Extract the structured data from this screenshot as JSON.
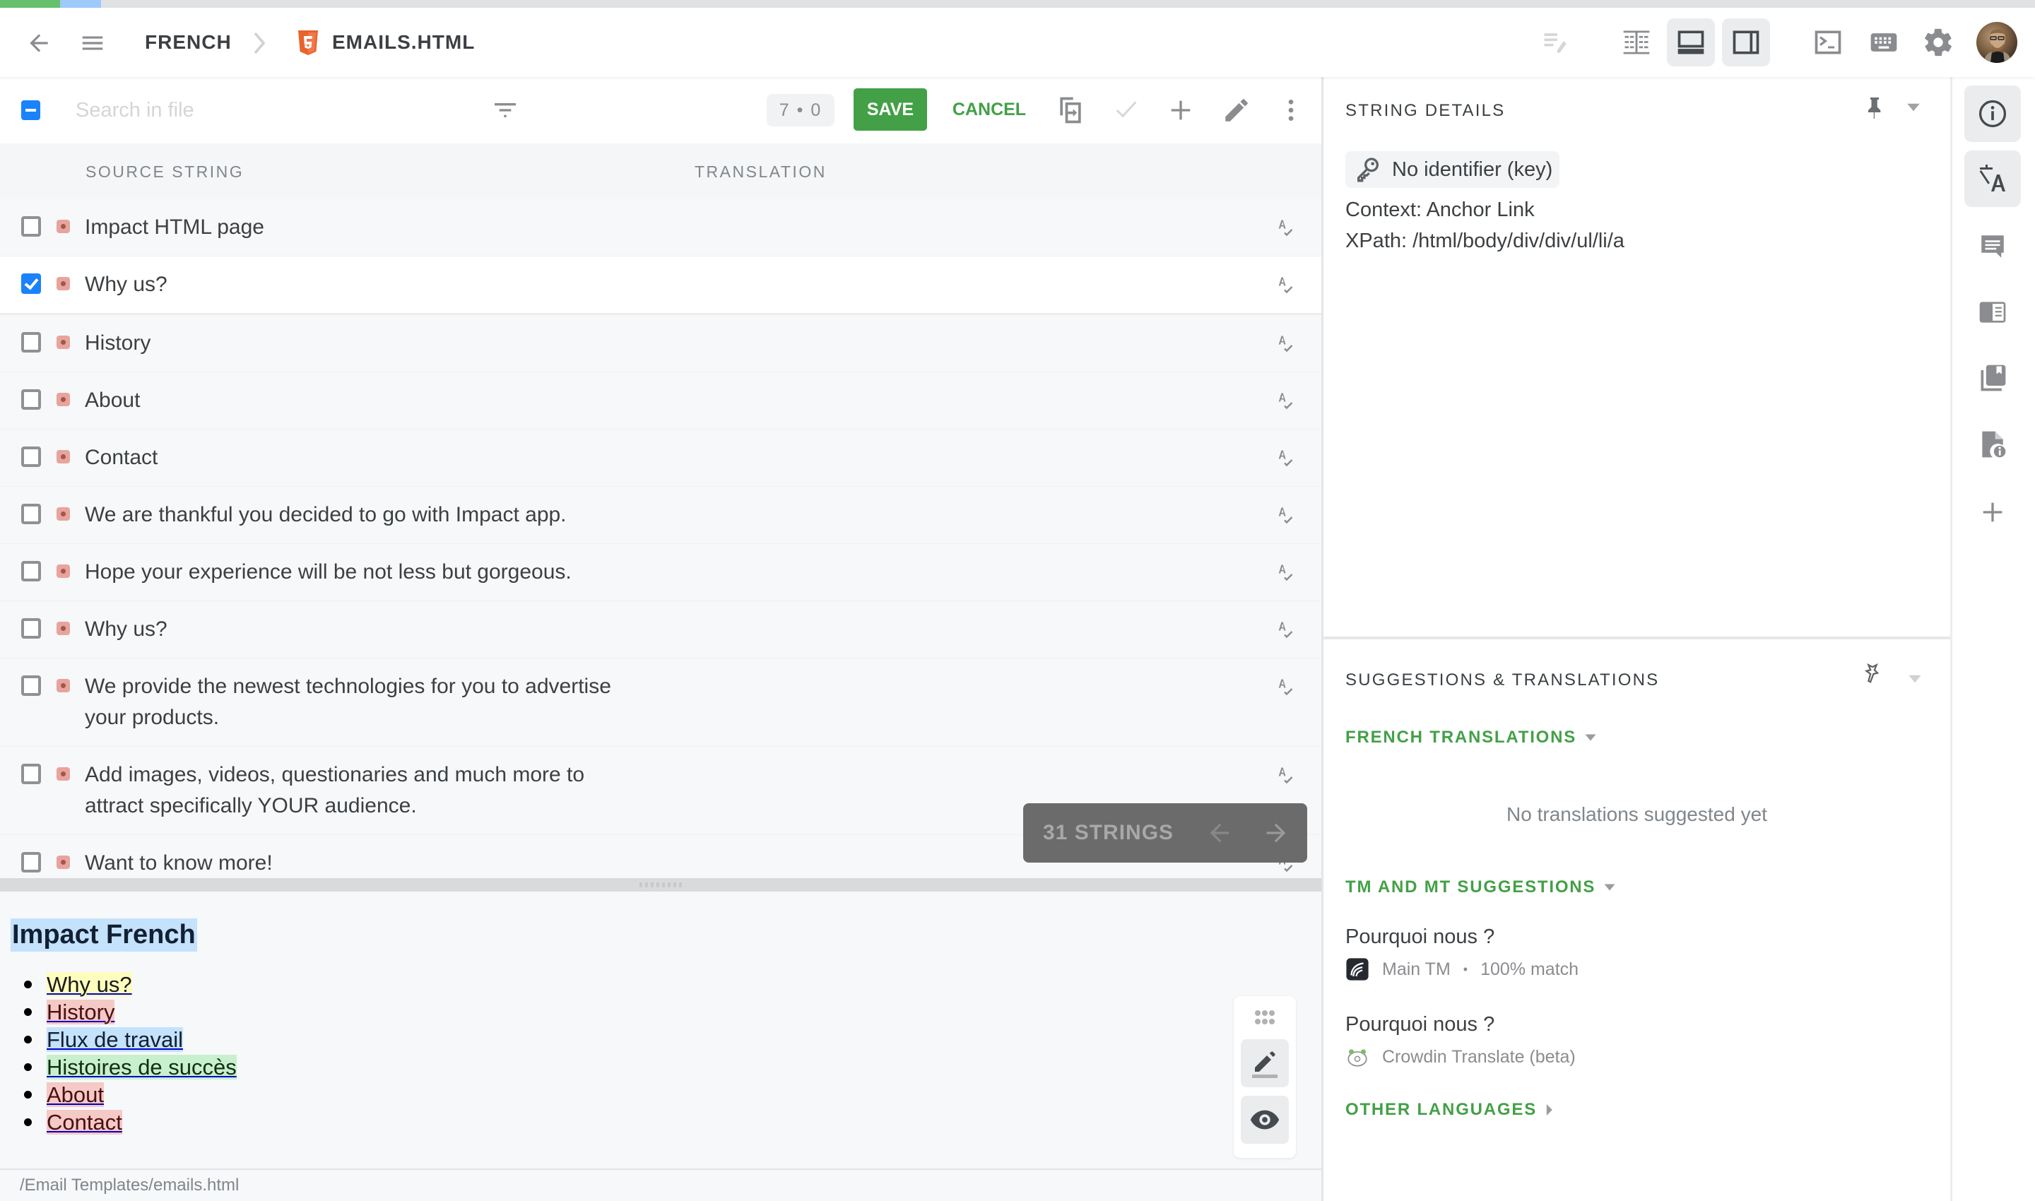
{
  "progress": {
    "translated_color": "#66c06c",
    "approved_color": "#9ec9fb",
    "remaining_color": "#e0e1e3"
  },
  "header": {
    "language": "FRENCH",
    "file_name": "EMAILS.HTML",
    "file_icon": "html5-icon",
    "icons": [
      "back-arrow-icon",
      "menu-icon",
      "chevron-right-icon",
      "edit-list-icon",
      "side-by-side-view-icon",
      "comfortable-view-icon",
      "multilingual-view-icon",
      "terminal-icon",
      "keyboard-icon",
      "settings-icon",
      "user-avatar"
    ]
  },
  "toolbar": {
    "search_placeholder": "Search in file",
    "search_value": "",
    "counter": "7 • 0",
    "save_label": "SAVE",
    "cancel_label": "CANCEL",
    "accent_color": "#43a047"
  },
  "columns": {
    "source": "SOURCE STRING",
    "translation": "TRANSLATION"
  },
  "strings": [
    {
      "text": "Impact HTML page",
      "checked": false
    },
    {
      "text": "Why us?",
      "checked": true
    },
    {
      "text": "History",
      "checked": false
    },
    {
      "text": "About",
      "checked": false
    },
    {
      "text": "Contact",
      "checked": false
    },
    {
      "text": "We are thankful you decided to go with Impact app.",
      "checked": false
    },
    {
      "text": "Hope your experience will be not less but gorgeous.",
      "checked": false
    },
    {
      "text": "Why us?",
      "checked": false
    },
    {
      "text": "We provide the newest technologies for you to advertise your products.",
      "checked": false
    },
    {
      "text": "Add images, videos, questionaries and much more to attract specifically YOUR audience.",
      "checked": false
    },
    {
      "text": "Want to know more!",
      "checked": false
    },
    {
      "text": "»",
      "checked": false
    }
  ],
  "pager": {
    "label": "31 STRINGS"
  },
  "preview": {
    "title": "Impact French",
    "links": [
      {
        "text": "Why us?",
        "bg": "#fdfdbe",
        "fg": "#1a1a1a"
      },
      {
        "text": "History",
        "bg": "#f5c9c6",
        "fg": "#4a0f0f"
      },
      {
        "text": "Flux de travail",
        "bg": "#c4e2fb",
        "fg": "#122033"
      },
      {
        "text": "Histoires de succès",
        "bg": "#c9f0cc",
        "fg": "#0f2e12"
      },
      {
        "text": "About",
        "bg": "#f5c9c6",
        "fg": "#4a0f0f"
      },
      {
        "text": "Contact",
        "bg": "#f5c9c6",
        "fg": "#4a0f0f"
      }
    ],
    "file_path": "/Email Templates/emails.html"
  },
  "details": {
    "title": "STRING DETAILS",
    "key": "No identifier (key)",
    "context": "Context: Anchor Link",
    "xpath": "XPath: /html/body/div/div/ul/li/a"
  },
  "suggestions": {
    "title": "SUGGESTIONS & TRANSLATIONS",
    "french_translations": "FRENCH TRANSLATIONS",
    "empty": "No translations suggested yet",
    "tm_mt": "TM AND MT SUGGESTIONS",
    "items": [
      {
        "text": "Pourquoi nous ?",
        "source": "Main TM",
        "match": "100% match"
      },
      {
        "text": "Pourquoi nous ?",
        "source": "Crowdin Translate (beta)"
      }
    ],
    "other_languages": "OTHER LANGUAGES"
  },
  "sidebar": {
    "items": [
      "info-icon",
      "translate-icon",
      "comments-icon",
      "glossary-icon",
      "translation-memory-icon",
      "file-info-icon",
      "add-icon"
    ]
  }
}
